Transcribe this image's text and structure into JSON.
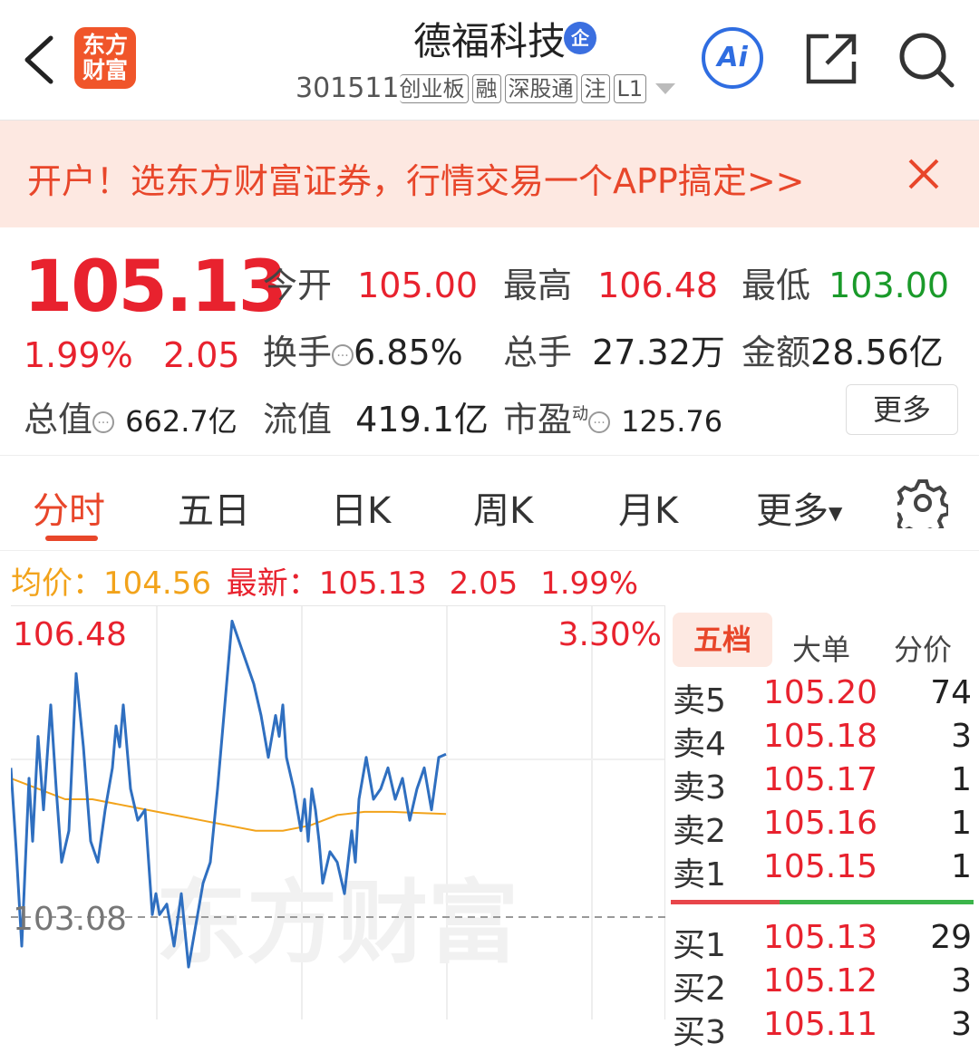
{
  "header": {
    "logo_text": "东方财富",
    "stock_name": "德福科技",
    "name_badge": "企",
    "code": "301511",
    "board_tags": [
      "创业板",
      "融",
      "深股通",
      "注",
      "L1"
    ],
    "ai_label": "Ai"
  },
  "banner": {
    "text": "开户！选东方财富证券，行情交易一个APP搞定>>"
  },
  "quote": {
    "price": "105.13",
    "change_pct": "1.99%",
    "change": "2.05",
    "open_label": "今开",
    "open": "105.00",
    "high_label": "最高",
    "high": "106.48",
    "low_label": "最低",
    "low": "103.00",
    "turnover_label": "换手",
    "turnover": "6.85%",
    "volume_label": "总手",
    "volume": "27.32万",
    "amount_label": "金额",
    "amount": "28.56亿",
    "mcap_label": "总值",
    "mcap": "662.7亿",
    "float_label": "流值",
    "float_cap": "419.1亿",
    "pe_label": "市盈",
    "pe_sup": "动",
    "pe": "125.76",
    "more_button": "更多"
  },
  "tabs": [
    "分时",
    "五日",
    "日K",
    "周K",
    "月K",
    "更多"
  ],
  "summary": {
    "avg_label": "均价：",
    "avg": "104.56",
    "latest_label": "最新：",
    "latest": "105.13",
    "change": "2.05",
    "pct": "1.99%"
  },
  "chart_data": {
    "type": "line",
    "y_max_label": "106.48",
    "y_pct_label": "3.30%",
    "y_base_label": "103.08",
    "watermark": "东方财富",
    "ylim": [
      102.6,
      106.55
    ],
    "x_range": [
      0,
      240
    ],
    "series": [
      {
        "x": [
          0,
          3,
          6,
          10,
          12,
          15,
          18,
          22,
          25,
          28,
          32,
          36,
          40,
          44,
          48,
          52,
          56,
          58,
          60,
          62,
          66,
          70,
          74,
          78,
          80,
          82,
          86,
          90,
          94,
          98,
          102,
          104,
          106,
          110,
          114,
          118,
          122,
          126,
          130,
          134,
          138,
          142,
          146,
          148,
          150,
          152,
          156,
          160,
          162,
          164,
          166,
          168,
          170,
          172,
          176,
          180,
          184,
          188,
          190,
          192,
          196,
          200,
          204,
          208,
          212,
          216,
          220,
          224,
          228,
          232,
          236,
          240
        ],
        "values": [
          105.0,
          104.2,
          103.3,
          104.9,
          104.3,
          105.3,
          104.6,
          105.6,
          104.8,
          104.1,
          104.4,
          105.9,
          105.2,
          104.3,
          104.1,
          104.6,
          105.0,
          105.4,
          105.2,
          105.6,
          104.8,
          104.5,
          104.6,
          103.6,
          103.8,
          103.6,
          103.7,
          103.3,
          103.8,
          103.1,
          103.5,
          103.7,
          103.9,
          104.1,
          104.8,
          105.6,
          106.4,
          106.2,
          106.0,
          105.8,
          105.5,
          105.1,
          105.5,
          105.3,
          105.6,
          105.1,
          104.8,
          104.4,
          104.7,
          104.3,
          104.8,
          104.6,
          104.3,
          103.9,
          104.2,
          104.1,
          103.8,
          104.4,
          104.1,
          104.7,
          105.1,
          104.7,
          104.8,
          105.0,
          104.7,
          104.9,
          104.5,
          104.8,
          105.0,
          104.6,
          105.1,
          105.13
        ]
      },
      {
        "x": [
          0,
          15,
          30,
          45,
          60,
          75,
          90,
          105,
          120,
          135,
          150,
          165,
          180,
          195,
          210,
          225,
          240
        ],
        "values": [
          104.9,
          104.8,
          104.7,
          104.7,
          104.65,
          104.6,
          104.55,
          104.5,
          104.45,
          104.4,
          104.4,
          104.45,
          104.55,
          104.58,
          104.58,
          104.57,
          104.56
        ]
      }
    ]
  },
  "order_book": {
    "tabs": [
      "五档",
      "大单",
      "分价"
    ],
    "asks": [
      {
        "name": "卖5",
        "price": "105.20",
        "volume": "74"
      },
      {
        "name": "卖4",
        "price": "105.18",
        "volume": "3"
      },
      {
        "name": "卖3",
        "price": "105.17",
        "volume": "1"
      },
      {
        "name": "卖2",
        "price": "105.16",
        "volume": "1"
      },
      {
        "name": "卖1",
        "price": "105.15",
        "volume": "1"
      }
    ],
    "bids": [
      {
        "name": "买1",
        "price": "105.13",
        "volume": "29"
      },
      {
        "name": "买2",
        "price": "105.12",
        "volume": "3"
      },
      {
        "name": "买3",
        "price": "105.11",
        "volume": "3"
      }
    ]
  },
  "colors": {
    "up": "#e8222e",
    "down": "#1a9a2a",
    "accent": "#e8462a",
    "price_line": "#2f6fc0",
    "avg_line": "#f2a31b"
  }
}
